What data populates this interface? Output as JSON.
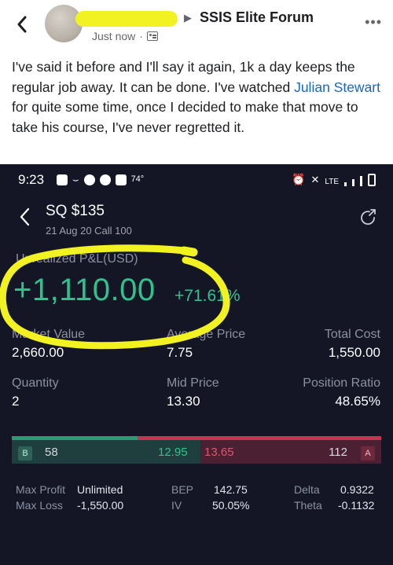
{
  "post": {
    "group_name": "SSIS Elite Forum",
    "timestamp": "Just now",
    "text_before_mention": "I've said it before and I'll say it again,  1k a day keeps the regular job away. It can be done. I've watched ",
    "mention": "Julian Stewart",
    "text_after_mention": " for quite some time, once I decided to make that move to take his course, I've never regretted it."
  },
  "status_bar": {
    "time": "9:23",
    "temperature": "74°",
    "network": "LTE"
  },
  "position": {
    "ticker": "SQ $135",
    "contract": "21 Aug 20 Call 100",
    "pl_label": "Unrealized P&L(USD)",
    "pl_value": "+1,110.00",
    "pl_percent": "+71.61%"
  },
  "stats": {
    "market_value_label": "Market Value",
    "market_value": "2,660.00",
    "avg_price_label": "Average Price",
    "avg_price": "7.75",
    "total_cost_label": "Total Cost",
    "total_cost": "1,550.00",
    "quantity_label": "Quantity",
    "quantity": "2",
    "mid_price_label": "Mid Price",
    "mid_price": "13.30",
    "position_ratio_label": "Position Ratio",
    "position_ratio": "48.65%"
  },
  "quote": {
    "bid_badge": "B",
    "bid_size": "58",
    "bid_price": "12.95",
    "ask_price": "13.65",
    "ask_size": "112",
    "ask_badge": "A"
  },
  "greeks": {
    "max_profit_label": "Max Profit",
    "max_profit": "Unlimited",
    "max_loss_label": "Max Loss",
    "max_loss": "-1,550.00",
    "bep_label": "BEP",
    "bep": "142.75",
    "iv_label": "IV",
    "iv": "50.05%",
    "delta_label": "Delta",
    "delta": "0.9322",
    "theta_label": "Theta",
    "theta": "-0.1132"
  },
  "colors": {
    "gain_green": "#2fc28c",
    "loss_red": "#e0566f",
    "highlight_yellow": "#f2f222",
    "app_background": "#141626",
    "link_blue": "#1a66c7"
  }
}
